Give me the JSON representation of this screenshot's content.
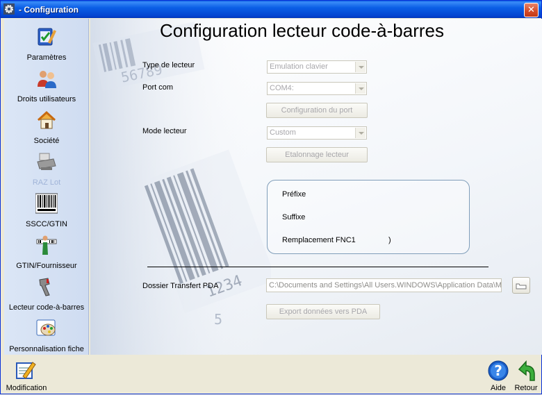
{
  "window": {
    "title": "- Configuration",
    "close_glyph": "✕"
  },
  "sidebar": {
    "items": [
      {
        "label": "Paramètres",
        "icon": "parameters-icon",
        "disabled": false
      },
      {
        "label": "Droits utilisateurs",
        "icon": "users-icon",
        "disabled": false
      },
      {
        "label": "Société",
        "icon": "house-icon",
        "disabled": false
      },
      {
        "label": "RAZ Lot",
        "icon": "printer-icon",
        "disabled": true
      },
      {
        "label": "SSCC/GTIN",
        "icon": "barcode-icon",
        "disabled": false
      },
      {
        "label": "GTIN/Fournisseur",
        "icon": "supplier-icon",
        "disabled": false
      },
      {
        "label": "Lecteur code-à-barres",
        "icon": "scanner-icon",
        "disabled": false
      },
      {
        "label": "Personnalisation fiche",
        "icon": "palette-icon",
        "disabled": false
      }
    ]
  },
  "main": {
    "title": "Configuration lecteur code-à-barres",
    "reader_type": {
      "label": "Type de lecteur",
      "value": "Emulation clavier"
    },
    "com_port": {
      "label": "Port com",
      "value": "COM4:"
    },
    "port_config_button": "Configuration du port",
    "reader_mode": {
      "label": "Mode lecteur",
      "value": "Custom"
    },
    "calibrate_button": "Etalonnage lecteur",
    "group": {
      "prefix_label": "Préfixe",
      "suffix_label": "Suffixe",
      "fnc1_label": "Remplacement FNC1",
      "fnc1_value": ")"
    },
    "pda_folder": {
      "label": "Dossier Transfert PDA",
      "value": "C:\\Documents and Settings\\All Users.WINDOWS\\Application Data\\M"
    },
    "export_button": "Export données vers PDA",
    "bg_numbers": [
      "56789",
      "1234",
      "5"
    ]
  },
  "bottom": {
    "modification": "Modification",
    "help": "Aide",
    "back": "Retour"
  }
}
